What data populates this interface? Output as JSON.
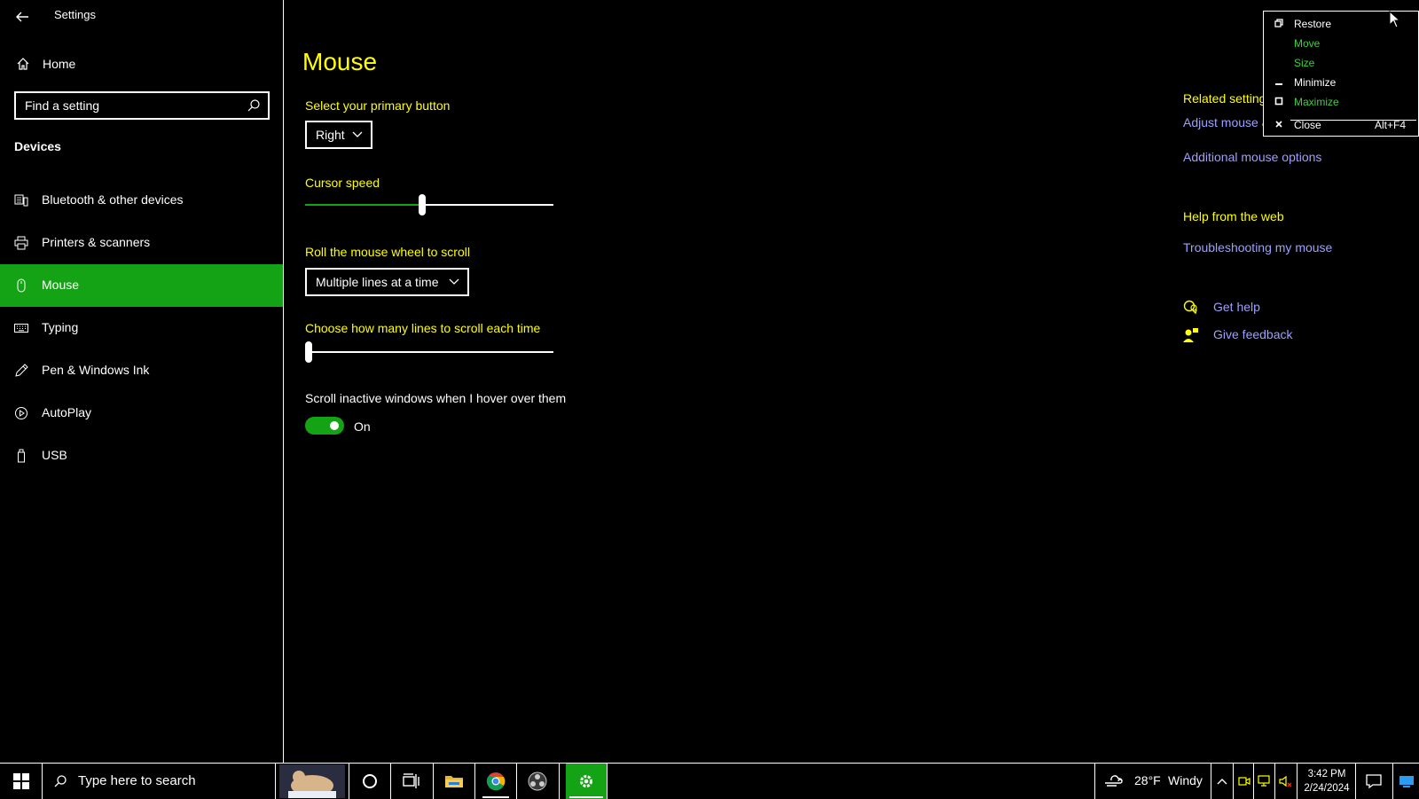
{
  "window": {
    "app_title": "Settings"
  },
  "sidebar": {
    "home_label": "Home",
    "search_placeholder": "Find a setting",
    "section_title": "Devices",
    "items": [
      {
        "label": "Bluetooth & other devices",
        "icon": "bluetooth-devices-icon"
      },
      {
        "label": "Printers & scanners",
        "icon": "printer-icon"
      },
      {
        "label": "Mouse",
        "icon": "mouse-icon",
        "selected": true
      },
      {
        "label": "Typing",
        "icon": "keyboard-icon"
      },
      {
        "label": "Pen & Windows Ink",
        "icon": "pen-icon"
      },
      {
        "label": "AutoPlay",
        "icon": "autoplay-icon"
      },
      {
        "label": "USB",
        "icon": "usb-icon"
      }
    ]
  },
  "main": {
    "title": "Mouse",
    "primary_button": {
      "label": "Select your primary button",
      "value": "Right"
    },
    "cursor_speed": {
      "label": "Cursor speed",
      "value_fraction": 0.47
    },
    "scroll_mode": {
      "label": "Roll the mouse wheel to scroll",
      "value": "Multiple lines at a time"
    },
    "scroll_lines": {
      "label": "Choose how many lines to scroll each time",
      "value_fraction": 0.0
    },
    "inactive_scroll": {
      "label": "Scroll inactive windows when I hover over them",
      "state": "On"
    }
  },
  "related": {
    "title": "Related settings",
    "links": [
      "Adjust mouse & cursor size",
      "Additional mouse options"
    ],
    "help_title": "Help from the web",
    "help_links": [
      "Troubleshooting my mouse"
    ],
    "get_help": "Get help",
    "give_feedback": "Give feedback"
  },
  "context_menu": {
    "items": [
      {
        "label": "Restore",
        "icon": "restore-icon",
        "color": "#ffffff"
      },
      {
        "label": "Move",
        "icon": "",
        "color": "#3bd23b"
      },
      {
        "label": "Size",
        "icon": "",
        "color": "#3bd23b"
      },
      {
        "label": "Minimize",
        "icon": "minimize-icon",
        "color": "#ffffff"
      },
      {
        "label": "Maximize",
        "icon": "maximize-icon",
        "color": "#3bd23b"
      },
      {
        "label": "Close",
        "icon": "close-icon",
        "color": "#ffffff",
        "accelerator": "Alt+F4"
      }
    ]
  },
  "taskbar": {
    "search_placeholder": "Type here to search",
    "weather_temp": "28°F",
    "weather_desc": "Windy",
    "time": "3:42 PM",
    "date": "2/24/2024"
  },
  "colors": {
    "accent": "#14a314",
    "heading": "#ffff00",
    "link": "#9f9fff"
  }
}
